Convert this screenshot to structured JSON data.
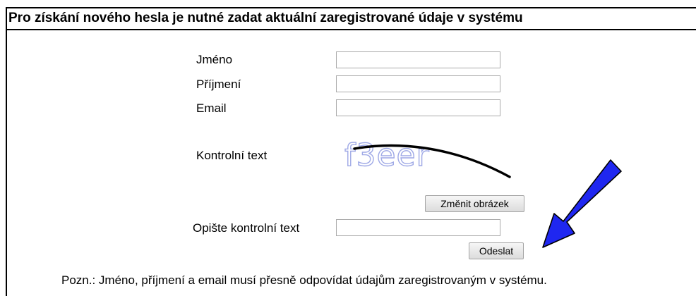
{
  "heading": "Pro získání nového hesla je nutné zadat aktuální zaregistrované údaje v systému",
  "form": {
    "first_name_label": "Jméno",
    "first_name_value": "",
    "last_name_label": "Příjmení",
    "last_name_value": "",
    "email_label": "Email",
    "email_value": "",
    "captcha_label": "Kontrolní text",
    "captcha_text": "f3eer",
    "change_image_button": "Změnit obrázek",
    "copy_label": "Opište kontrolní text",
    "copy_value": "",
    "submit_button": "Odeslat"
  },
  "note": "Pozn.: Jméno, příjmení a email musí přesně odpovídat údajům zaregistrovaným v systému.",
  "colors": {
    "annotation_arrow": "#1f27f0",
    "captcha_text": "#9fa9e6"
  },
  "icons": [
    "annotation-arrow-icon"
  ]
}
